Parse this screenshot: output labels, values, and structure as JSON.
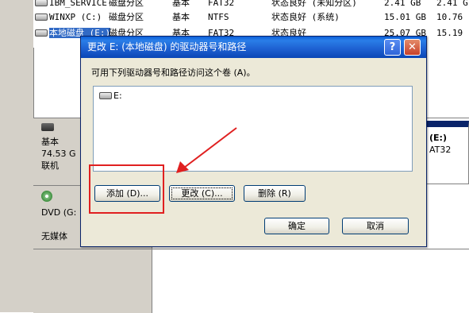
{
  "volumes": [
    {
      "name": "IBM_SERVICE",
      "layout": "磁盘分区",
      "type": "基本",
      "fs": "FAT32",
      "status": "状态良好 (未知分区)",
      "capacity": "2.41 GB",
      "free": "2.41 G"
    },
    {
      "name": "WINXP (C:)",
      "layout": "磁盘分区",
      "type": "基本",
      "fs": "NTFS",
      "status": "状态良好 (系统)",
      "capacity": "15.01 GB",
      "free": "10.76"
    },
    {
      "name": "本地磁盘 (E:)",
      "layout": "磁盘分区",
      "type": "基本",
      "fs": "FAT32",
      "status": "状态良好",
      "capacity": "25.07 GB",
      "free": "15.19"
    }
  ],
  "disk0": {
    "type": "基本",
    "size": "74.53 G",
    "status": "联机"
  },
  "cdrom": {
    "name": "DVD (G:",
    "status": "无媒体"
  },
  "partition_e": {
    "label": "(E:)",
    "fs": "AT32"
  },
  "dialog": {
    "title": "更改 E: (本地磁盘) 的驱动器号和路径",
    "help": "?",
    "close": "✕",
    "prompt": "可用下列驱动器号和路径访问这个卷 (A)。",
    "list_items": [
      "E:"
    ],
    "add_label": "添加 (D)...",
    "change_label": "更改 (C)...",
    "remove_label": "删除 (R)",
    "ok_label": "确定",
    "cancel_label": "取消"
  },
  "colors": {
    "annotation": "#e02020",
    "titlebar": "#0a5fd8",
    "selection": "#316ac5"
  }
}
